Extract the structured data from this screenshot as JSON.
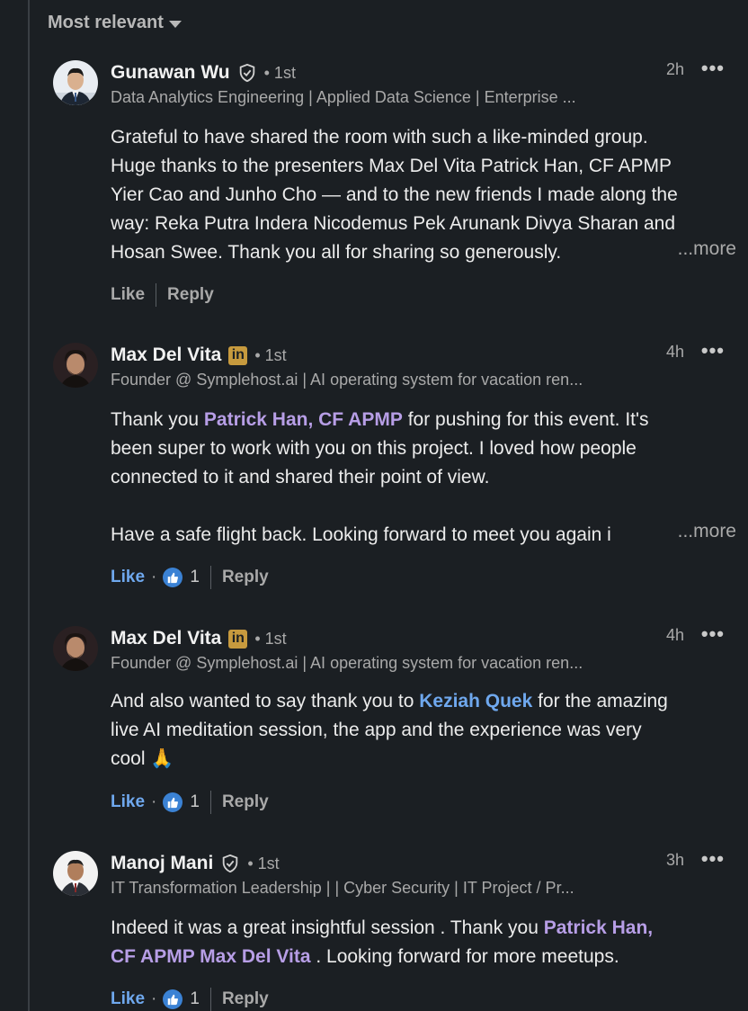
{
  "sort": {
    "label": "Most relevant"
  },
  "comments": [
    {
      "name": "Gunawan Wu",
      "badge": "verified",
      "degree": "• 1st",
      "time": "2h",
      "headline": "Data Analytics Engineering | Applied Data Science | Enterprise ...",
      "text_lines": [
        "Grateful to have shared the room with such a like-minded group.",
        "Huge thanks to the presenters Max Del Vita Patrick Han, CF APMP",
        "Yier Cao and Junho Cho — and to the new friends I made along the",
        "way: Reka Putra Indera Nicodemus Pek Arunank Divya Sharan and",
        "Hosan Swee. Thank you all for sharing so generously."
      ],
      "more": "...more",
      "like": "Like",
      "reply": "Reply"
    },
    {
      "name": "Max Del Vita",
      "badge": "in",
      "badge_text": "in",
      "degree": "• 1st",
      "time": "4h",
      "headline": "Founder @ Symplehost.ai | AI operating system for vacation ren...",
      "text_pre": "Thank you ",
      "mention": "Patrick Han, CF APMP",
      "text_post": " for pushing for this event. It's",
      "line2": "been super to work with you on this project. I loved how people",
      "line3": "connected to it and shared their point of view.",
      "line5": "Have a safe flight back. Looking forward to meet you again i",
      "more": "...more",
      "like": "Like",
      "reactions": "1",
      "reply": "Reply"
    },
    {
      "name": "Max Del Vita",
      "badge": "in",
      "badge_text": "in",
      "degree": "• 1st",
      "time": "4h",
      "headline": "Founder @ Symplehost.ai | AI operating system for vacation ren...",
      "text_pre": "And also wanted to say thank you to ",
      "mention": "Keziah Quek",
      "text_post": " for the amazing",
      "line2": "live AI meditation session, the app and the experience was very",
      "line3": "cool 🙏",
      "like": "Like",
      "reactions": "1",
      "reply": "Reply"
    },
    {
      "name": "Manoj Mani",
      "badge": "verified",
      "degree": "• 1st",
      "time": "3h",
      "headline": "IT Transformation Leadership | | Cyber Security | IT Project / Pr...",
      "text_pre": "Indeed it was a great insightful session . Thank you ",
      "mention": "Patrick Han,",
      "mention2": "CF APMP Max Del Vita",
      "text_post": " . Looking forward for more meetups.",
      "like": "Like",
      "reactions": "1",
      "reply": "Reply"
    }
  ],
  "colors": {
    "background": "#1b1f23",
    "mention_purple": "#b79ee6",
    "mention_blue": "#6fa8ee",
    "linkedin_badge": "#c79a3e"
  },
  "icons": [
    "chevron-down-icon",
    "verified-shield-icon",
    "linkedin-badge-icon",
    "more-options-icon",
    "thumbs-up-reaction-icon"
  ]
}
